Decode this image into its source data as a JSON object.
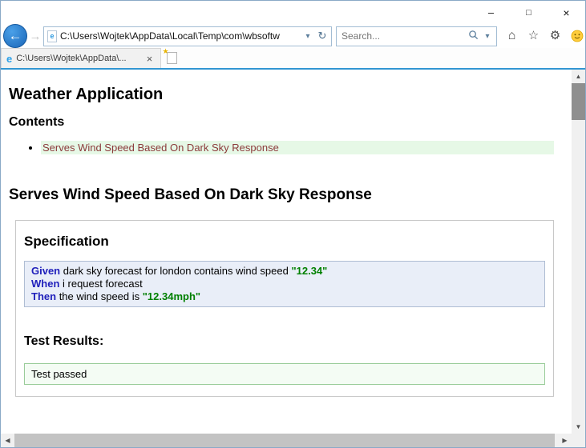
{
  "colors": {
    "accent_line": "#3296d2",
    "back_button_blue": "#1f7ad0",
    "toc_link": "#8b3a3a",
    "toc_highlight": "#e6f8e6",
    "step_keyword": "#2020bb",
    "step_value": "#008000",
    "spec_bg": "#e9eef8",
    "spec_border": "#afbdd3",
    "result_bg": "#f4fcf4",
    "result_border": "#99cc99"
  },
  "window": {
    "minimize": "–",
    "maximize": "□",
    "close": "×"
  },
  "browser": {
    "address_url": "C:\\Users\\Wojtek\\AppData\\Local\\Temp\\com\\wbsoftw",
    "search_placeholder": "Search...",
    "tab_title": "C:\\Users\\Wojtek\\AppData\\...",
    "tab_close": "×"
  },
  "icons": {
    "back": "←",
    "forward": "→",
    "dropdown": "▾",
    "refresh": "↻",
    "home": "⌂",
    "favorites": "☆",
    "settings": "⚙",
    "page_e": "e",
    "tab_e": "e",
    "new_tab_star": "★",
    "scroll_up": "▲",
    "scroll_down": "▼",
    "scroll_left": "◀",
    "scroll_right": "▶"
  },
  "page": {
    "title": "Weather Application",
    "contents_heading": "Contents",
    "toc": [
      {
        "label": "Serves Wind Speed Based On Dark Sky Response"
      }
    ],
    "scenario_heading": "Serves Wind Speed Based On Dark Sky Response",
    "specification_heading": "Specification",
    "steps": [
      {
        "keyword": "Given",
        "text": "dark sky forecast for london contains wind speed",
        "value": "\"12.34\""
      },
      {
        "keyword": "When",
        "text": "i request forecast",
        "value": ""
      },
      {
        "keyword": "Then",
        "text": "the wind speed is",
        "value": "\"12.34mph\""
      }
    ],
    "results_heading": "Test Results:",
    "result": "Test passed"
  }
}
